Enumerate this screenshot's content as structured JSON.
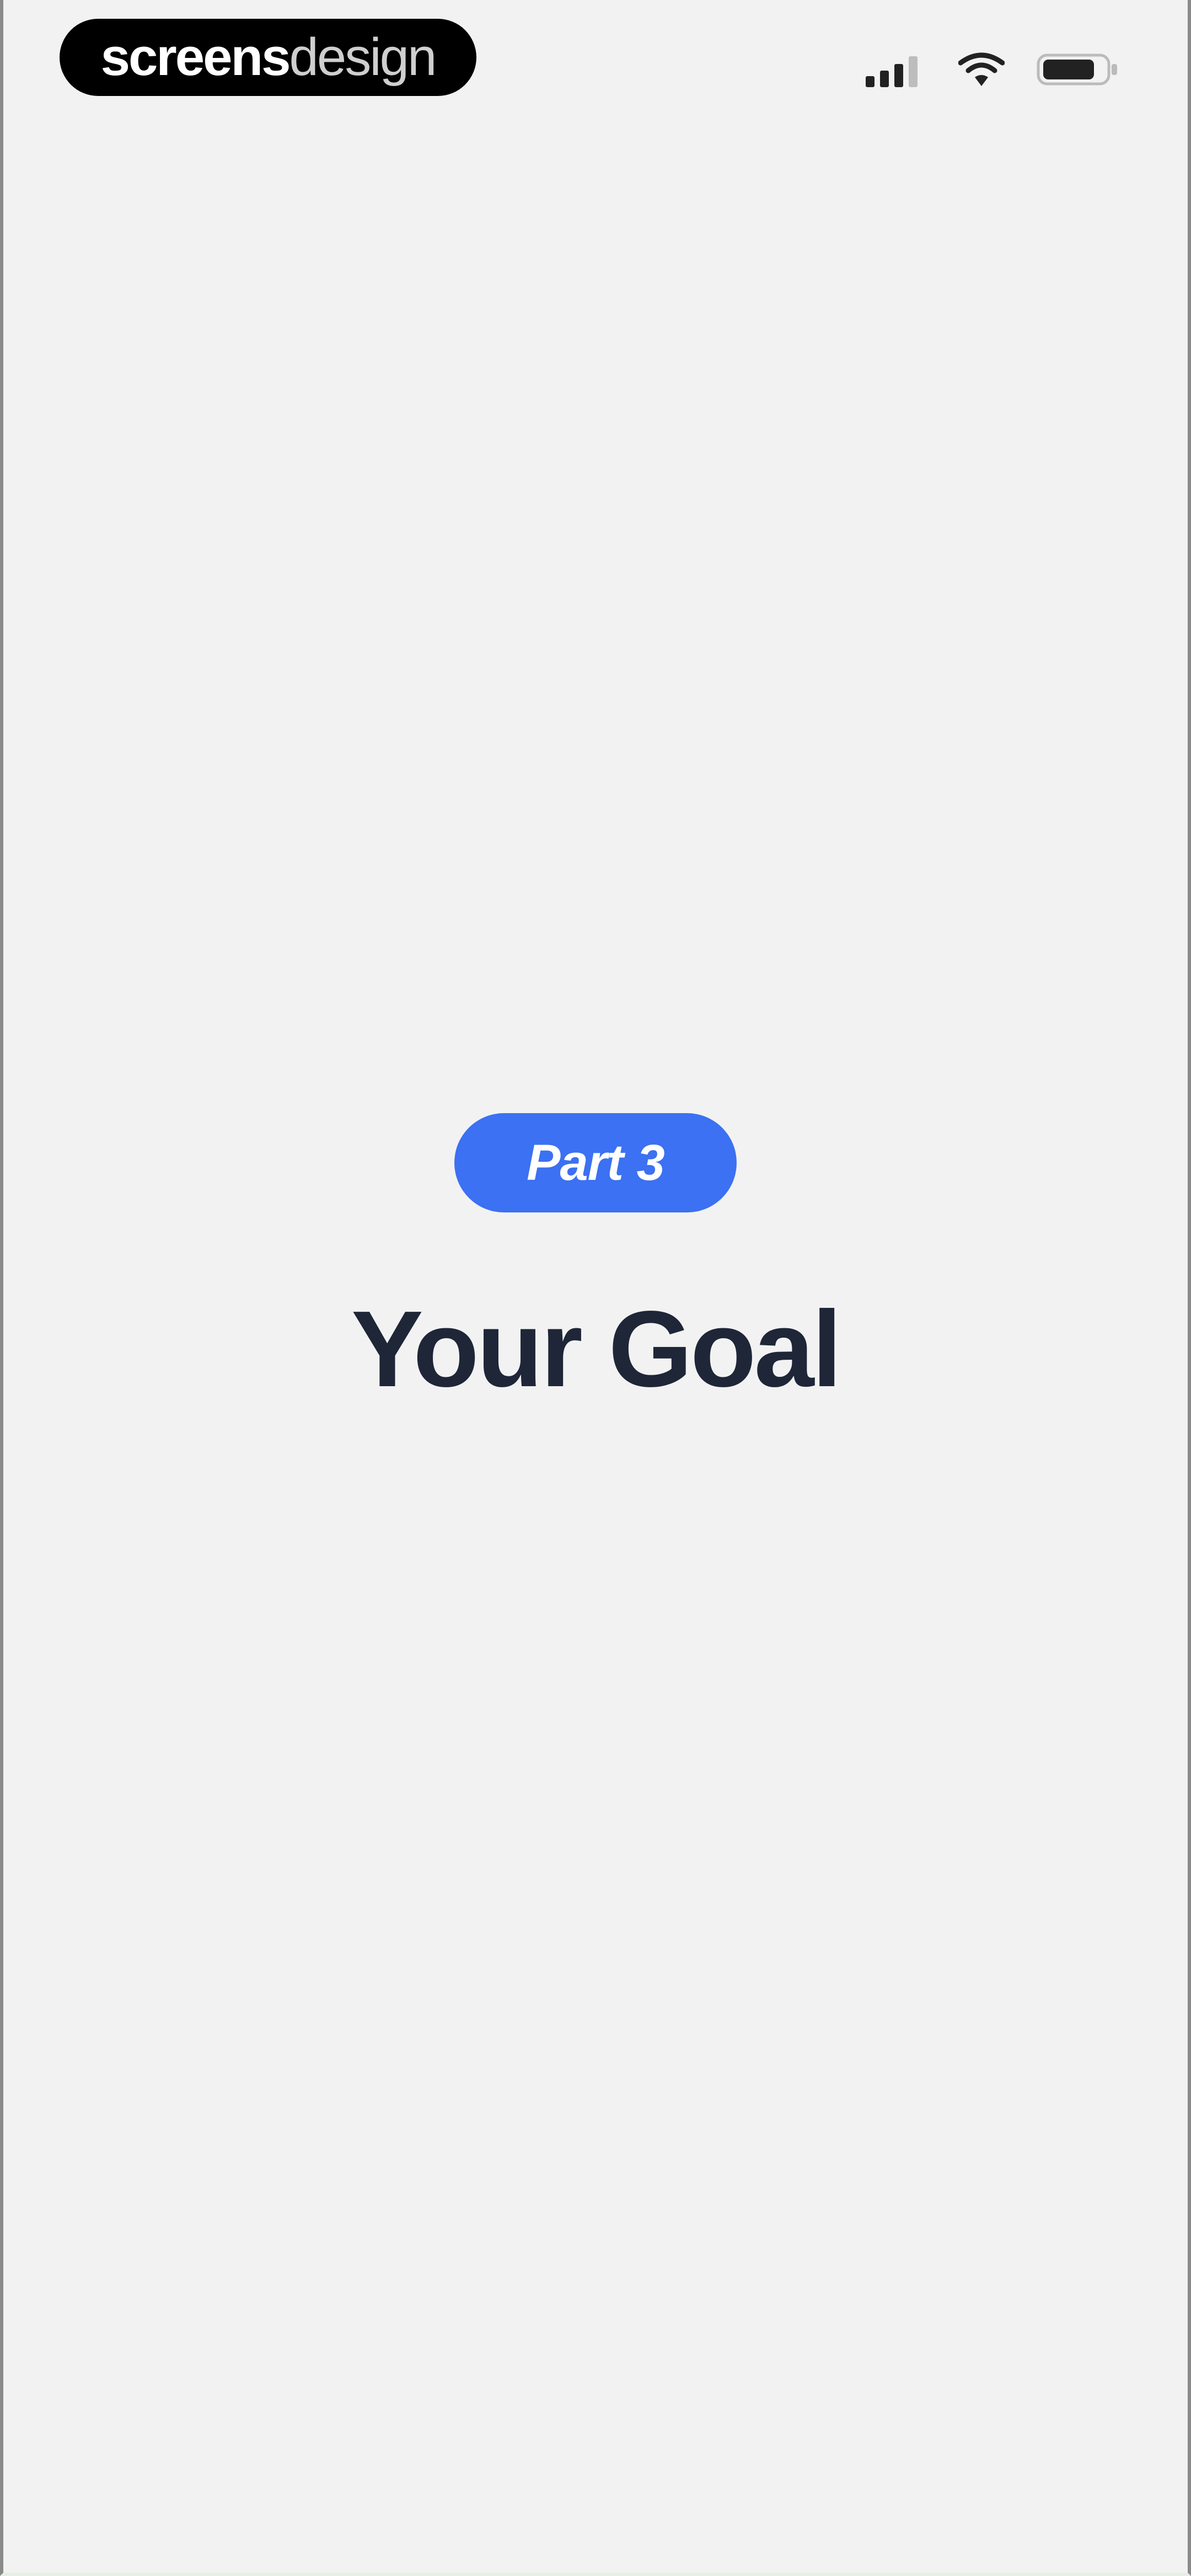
{
  "status_bar": {
    "brand": {
      "bold": "screens",
      "light": "design"
    },
    "icons": [
      "cellular-signal-icon",
      "wifi-icon",
      "battery-icon"
    ]
  },
  "main": {
    "badge_label": "Part 3",
    "title": "Your Goal"
  },
  "colors": {
    "accent": "#3b71f2",
    "title": "#1e2638",
    "background": "#f2f2f2"
  }
}
